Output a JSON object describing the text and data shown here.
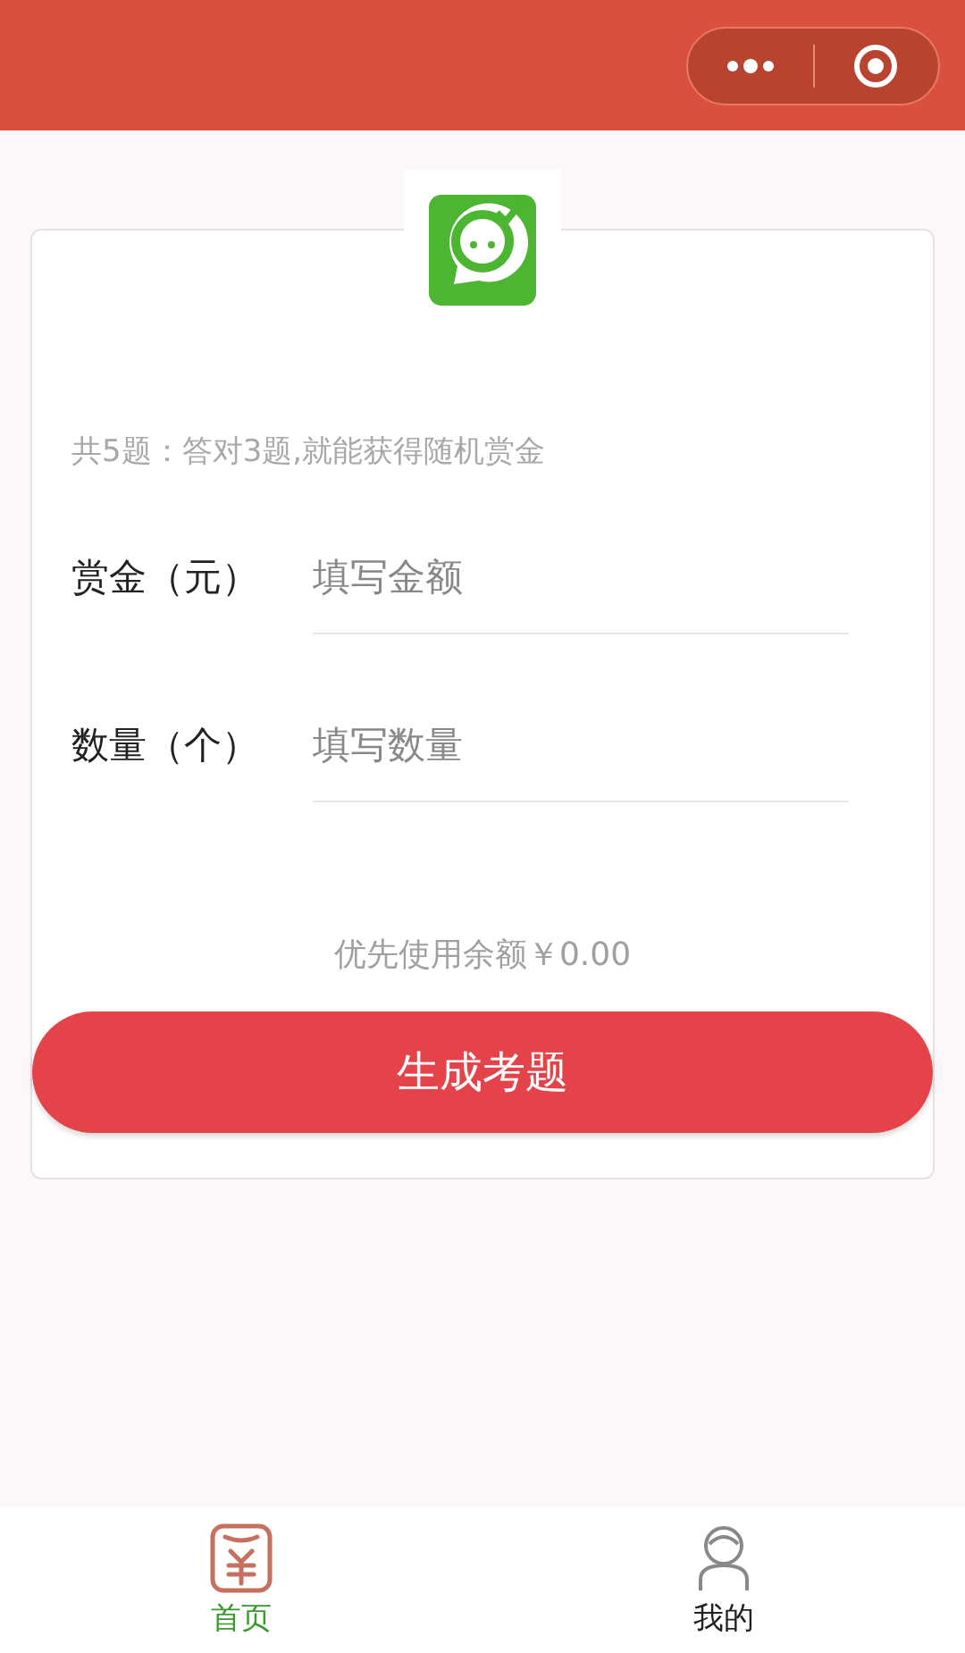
{
  "hint": "共5题：答对3题,就能获得随机赏金",
  "fields": [
    {
      "label": "赏金（元）",
      "placeholder": "填写金额"
    },
    {
      "label": "数量（个）",
      "placeholder": "填写数量"
    }
  ],
  "balance_note": "优先使用余额￥0.00",
  "submit_button": "生成考题",
  "tab_bar": [
    {
      "label": "首页",
      "kind": "wallet",
      "selected": true
    },
    {
      "label": "我的",
      "kind": "person",
      "selected": false
    }
  ]
}
